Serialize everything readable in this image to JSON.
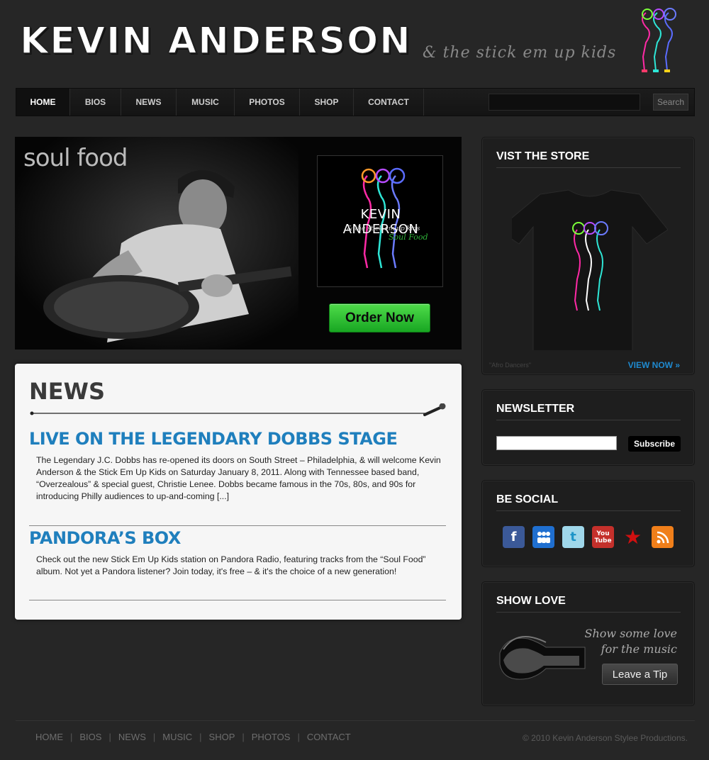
{
  "header": {
    "brand": "KEVIN ANDERSON",
    "tagline": "& the stick em up kids"
  },
  "nav": {
    "items": [
      "HOME",
      "BIOS",
      "NEWS",
      "MUSIC",
      "PHOTOS",
      "SHOP",
      "CONTACT"
    ],
    "search_button": "Search"
  },
  "hero": {
    "title": "soul food",
    "album_artist": "KEVIN ANDERSON",
    "album_subtitle": "& the stick em up kids",
    "album_title": "Soul Food",
    "order_button": "Order Now"
  },
  "news": {
    "heading": "NEWS",
    "posts": [
      {
        "title": "LIVE ON THE LEGENDARY DOBBS STAGE",
        "body": "The Legendary J.C. Dobbs has re-opened its doors on South Street – Philadelphia, & will welcome Kevin Anderson & the Stick Em Up Kids on Saturday January 8, 2011.  Along with Tennessee based band, “Overzealous”  & special guest, Christie Lenee. Dobbs became famous in the 70s, 80s, and 90s for introducing Philly audiences to up-and-coming [...]"
      },
      {
        "title": "PANDORA’S BOX",
        "body": "Check out the new Stick Em Up Kids station on Pandora Radio, featuring tracks from the “Soul Food” album. Not yet a Pandora listener? Join today, it's free – & it's the choice of a new generation!"
      }
    ]
  },
  "sidebar": {
    "store": {
      "title": "VIST THE STORE",
      "caption": "\"Afro Dancers\"",
      "link": "VIEW NOW »"
    },
    "newsletter": {
      "title": "NEWSLETTER",
      "button": "Subscribe"
    },
    "social": {
      "title": "BE SOCIAL",
      "icons": [
        "facebook-icon",
        "myspace-icon",
        "twitter-icon",
        "youtube-icon",
        "star-icon",
        "rss-icon"
      ],
      "colors": [
        "#3b5998",
        "#1f6fd0",
        "#9fd7ea",
        "#c4302b",
        "#d01010",
        "#f07f1a"
      ]
    },
    "love": {
      "title": "SHOW LOVE",
      "text": "Show some love for the music",
      "button": "Leave a Tip"
    }
  },
  "footer": {
    "links": [
      "HOME",
      "BIOS",
      "NEWS",
      "MUSIC",
      "SHOP",
      "PHOTOS",
      "CONTACT"
    ],
    "copyright": "© 2010 Kevin Anderson Stylee Productions."
  },
  "colors": {
    "accent_blue": "#1f7fbd",
    "order_green": "#18a622",
    "background": "#262626"
  }
}
